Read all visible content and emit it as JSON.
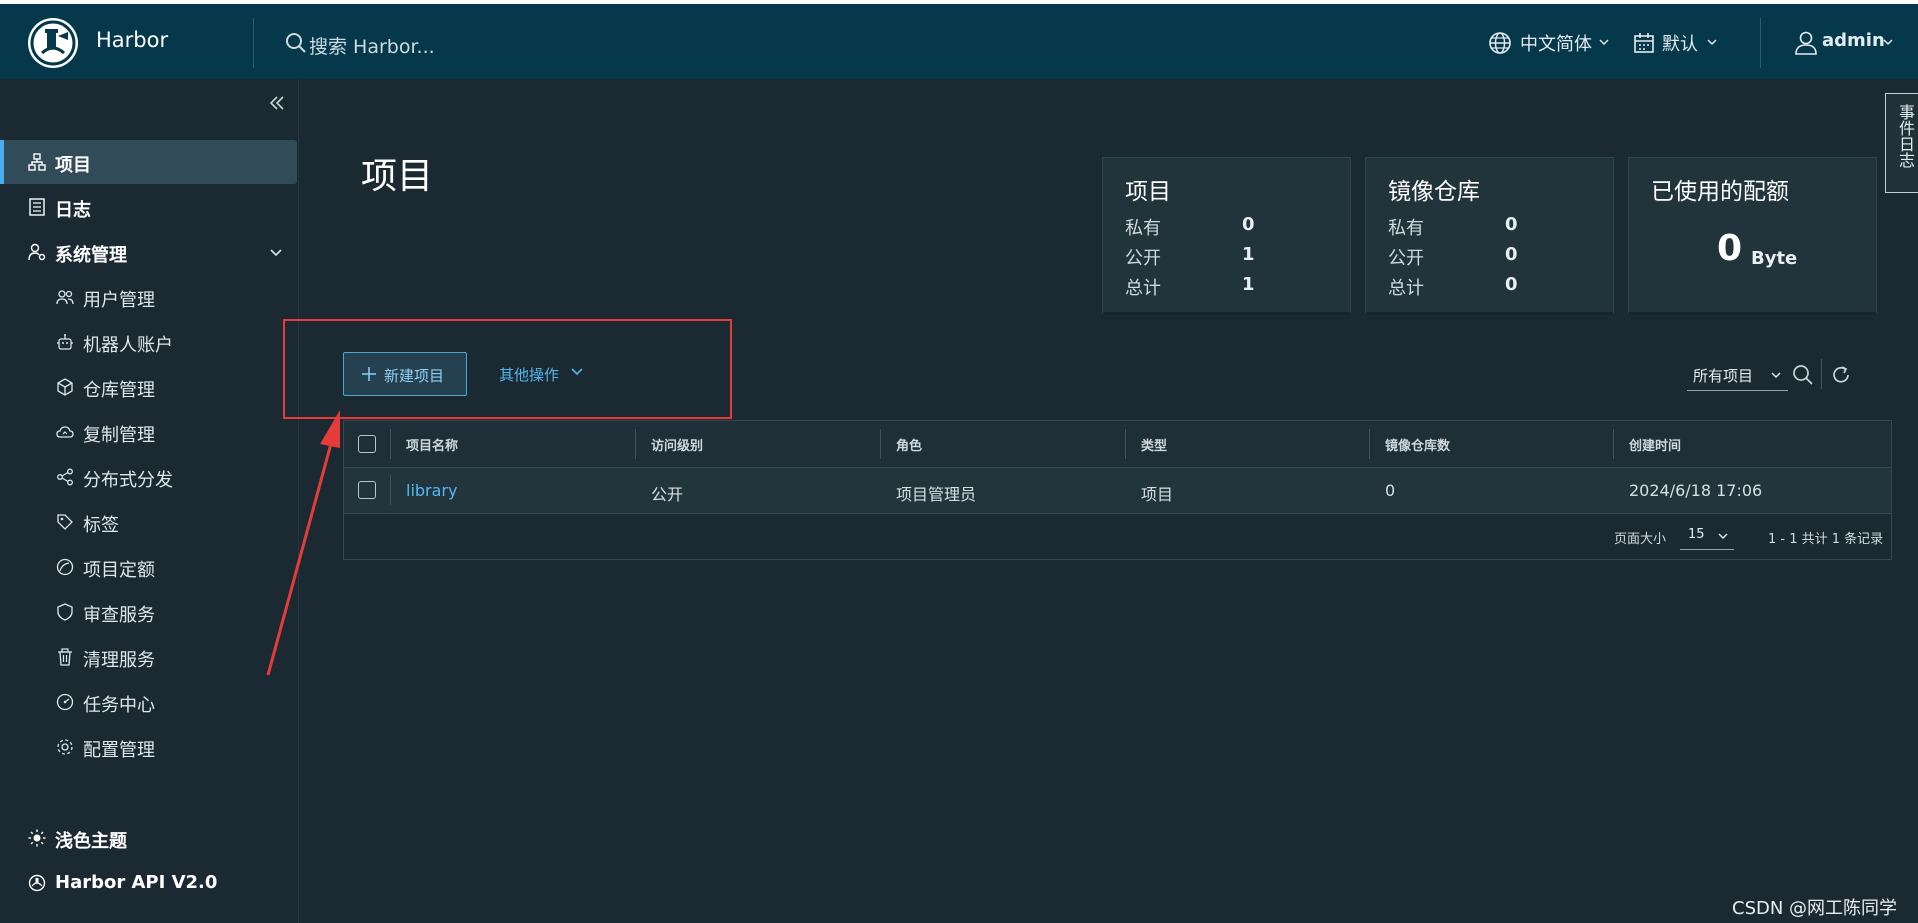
{
  "header": {
    "brand": "Harbor",
    "search_placeholder": "搜索 Harbor...",
    "language": "中文简体",
    "date_format": "默认",
    "user": "admin"
  },
  "sidebar": {
    "items": [
      {
        "label": "项目",
        "icon": "projects-icon",
        "active": true
      },
      {
        "label": "日志",
        "icon": "logs-icon"
      },
      {
        "label": "系统管理",
        "icon": "admin-icon",
        "expandable": true
      },
      {
        "label": "用户管理",
        "icon": "users-icon"
      },
      {
        "label": "机器人账户",
        "icon": "robot-icon"
      },
      {
        "label": "仓库管理",
        "icon": "registry-icon"
      },
      {
        "label": "复制管理",
        "icon": "replication-icon"
      },
      {
        "label": "分布式分发",
        "icon": "share-icon"
      },
      {
        "label": "标签",
        "icon": "tag-icon"
      },
      {
        "label": "项目定额",
        "icon": "quota-icon"
      },
      {
        "label": "审查服务",
        "icon": "shield-icon"
      },
      {
        "label": "清理服务",
        "icon": "trash-icon"
      },
      {
        "label": "任务中心",
        "icon": "dashboard-icon"
      },
      {
        "label": "配置管理",
        "icon": "gear-icon"
      }
    ],
    "theme": "浅色主题",
    "api": "Harbor API V2.0"
  },
  "main": {
    "title": "项目",
    "cards": {
      "projects": {
        "title": "项目",
        "private_label": "私有",
        "private": "0",
        "public_label": "公开",
        "public": "1",
        "total_label": "总计",
        "total": "1"
      },
      "repos": {
        "title": "镜像仓库",
        "private_label": "私有",
        "private": "0",
        "public_label": "公开",
        "public": "0",
        "total_label": "总计",
        "total": "0"
      },
      "quota": {
        "title": "已使用的配额",
        "value": "0",
        "unit": "Byte"
      }
    },
    "event_log_tab": "事件日志",
    "new_project_button": "新建项目",
    "more_actions": "其他操作",
    "filter_value": "所有项目",
    "table": {
      "columns": [
        "项目名称",
        "访问级别",
        "角色",
        "类型",
        "镜像仓库数",
        "创建时间"
      ],
      "rows": [
        {
          "name": "library",
          "access": "公开",
          "role": "项目管理员",
          "type": "项目",
          "repo_count": "0",
          "created": "2024/6/18 17:06"
        }
      ],
      "page_size_label": "页面大小",
      "page_size": "15",
      "summary": "1 - 1 共计 1 条记录"
    }
  },
  "watermark": "CSDN @网工陈同学",
  "colors": {
    "header_bg": "#04384a",
    "sidebar_bg": "#1b2a32",
    "accent": "#49aeed",
    "annotation_red": "#e53b3b"
  }
}
